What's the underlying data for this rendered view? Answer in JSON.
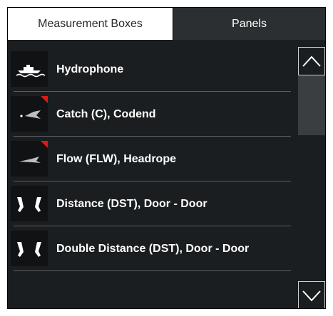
{
  "tabs": {
    "measurement_boxes": "Measurement Boxes",
    "panels": "Panels"
  },
  "items": [
    {
      "label": "Hydrophone",
      "icon": "hydrophone-icon",
      "flag": false
    },
    {
      "label": "Catch (C), Codend",
      "icon": "catch-sensor-icon",
      "flag": true
    },
    {
      "label": "Flow (FLW), Headrope",
      "icon": "flow-sensor-icon",
      "flag": true
    },
    {
      "label": "Distance (DST), Door - Door",
      "icon": "trawl-doors-icon",
      "flag": false
    },
    {
      "label": "Double Distance (DST), Door - Door",
      "icon": "trawl-doors-icon",
      "flag": false
    }
  ],
  "colors": {
    "background": "#1b1e20",
    "active_tab": "#ffffff",
    "inactive_tab": "#2b2f31",
    "flag": "#e01818"
  }
}
